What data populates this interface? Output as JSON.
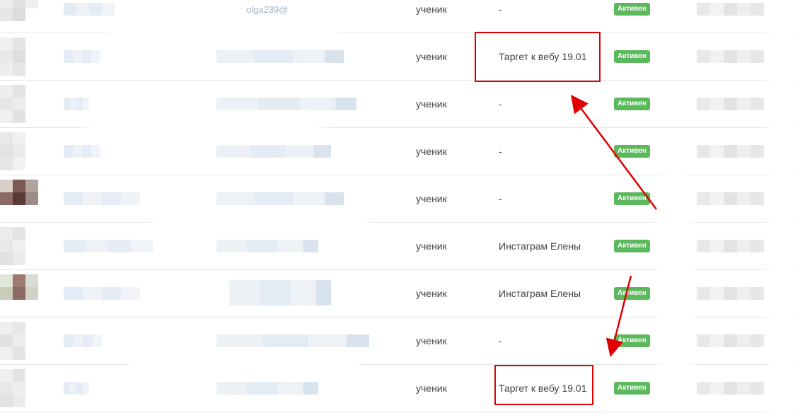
{
  "table": {
    "rows": [
      {
        "email_fragment": "olga239@",
        "role": "ученик",
        "source": "-",
        "status": "Активен"
      },
      {
        "email_fragment": "",
        "role": "ученик",
        "source": "Таргет к вебу 19.01",
        "status": "Активен"
      },
      {
        "email_fragment": "",
        "role": "ученик",
        "source": "-",
        "status": "Активен"
      },
      {
        "email_fragment": "",
        "role": "ученик",
        "source": "-",
        "status": "Активен"
      },
      {
        "email_fragment": "",
        "role": "ученик",
        "source": "-",
        "status": "Активен"
      },
      {
        "email_fragment": "",
        "role": "ученик",
        "source": "Инстаграм Елены",
        "status": "Активен"
      },
      {
        "email_fragment": "",
        "role": "ученик",
        "source": "Инстаграм Елены",
        "status": "Активен"
      },
      {
        "email_fragment": "",
        "role": "ученик",
        "source": "-",
        "status": "Активен"
      },
      {
        "email_fragment": "",
        "role": "ученик",
        "source": "Таргет к вебу 19.01",
        "status": "Активен"
      }
    ]
  },
  "colors": {
    "status_badge": "#5cb85c",
    "annotation": "#e00000"
  }
}
